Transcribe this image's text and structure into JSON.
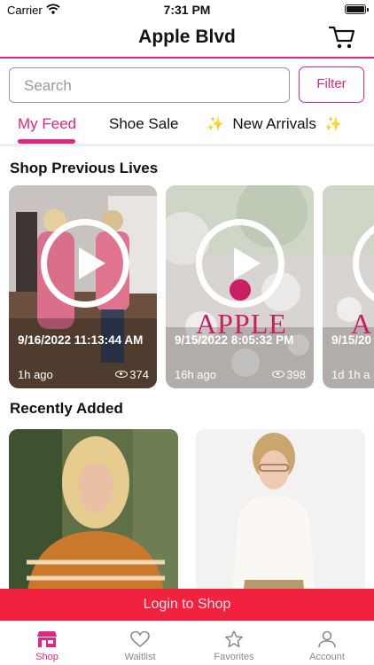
{
  "status_bar": {
    "carrier": "Carrier",
    "time": "7:31 PM"
  },
  "header": {
    "title": "Apple Blvd",
    "cart_icon": "shopping-cart-icon"
  },
  "search": {
    "placeholder": "Search",
    "filter_label": "Filter"
  },
  "tabs": [
    {
      "label": "My Feed",
      "active": true
    },
    {
      "label": "Shoe Sale",
      "active": false
    },
    {
      "label": "New Arrivals",
      "active": false,
      "decor": "✨"
    }
  ],
  "previous_lives": {
    "title": "Shop Previous Lives",
    "items": [
      {
        "date": "9/16/2022 11:13:44 AM",
        "ago": "1h ago",
        "views": "374"
      },
      {
        "date": "9/15/2022 8:05:32 PM",
        "ago": "16h ago",
        "views": "398",
        "brand": "APPLE"
      },
      {
        "date": "9/15/20",
        "ago": "1d 1h a",
        "brand": "A"
      }
    ]
  },
  "recently_added": {
    "title": "Recently Added"
  },
  "login_banner": {
    "label": "Login to Shop"
  },
  "bottom_tabs": [
    {
      "label": "Shop",
      "icon": "store-icon",
      "active": true
    },
    {
      "label": "Waitlist",
      "icon": "heart-icon",
      "active": false
    },
    {
      "label": "Favorites",
      "icon": "star-icon",
      "active": false
    },
    {
      "label": "Account",
      "icon": "person-icon",
      "active": false
    }
  ],
  "colors": {
    "accent": "#e4257f",
    "login_bar": "#f0223f"
  }
}
